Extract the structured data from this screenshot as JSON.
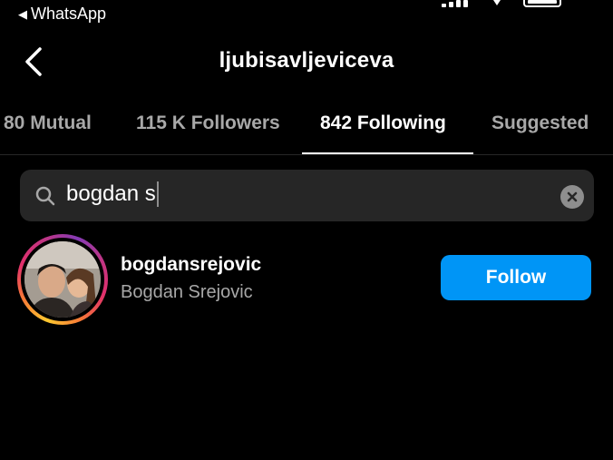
{
  "status_bar": {
    "back_app_label": "WhatsApp",
    "back_app_icon": "triangle-left-icon"
  },
  "header": {
    "title": "ljubisavljeviceva",
    "back_icon": "chevron-left-icon"
  },
  "tabs": [
    {
      "label": "80 Mutual",
      "active": false
    },
    {
      "label": "115 K Followers",
      "active": false
    },
    {
      "label": "842 Following",
      "active": true
    },
    {
      "label": "Suggested",
      "active": false
    }
  ],
  "search": {
    "value": "bogdan s",
    "icon": "search-icon",
    "clear_icon": "clear-icon"
  },
  "results": [
    {
      "username": "bogdansrejovic",
      "full_name": "Bogdan Srejovic",
      "has_story_ring": true,
      "button_label": "Follow"
    }
  ],
  "colors": {
    "background": "#000000",
    "accent": "#0095f6",
    "muted_text": "#a8a8a8",
    "search_bg": "#262626"
  }
}
